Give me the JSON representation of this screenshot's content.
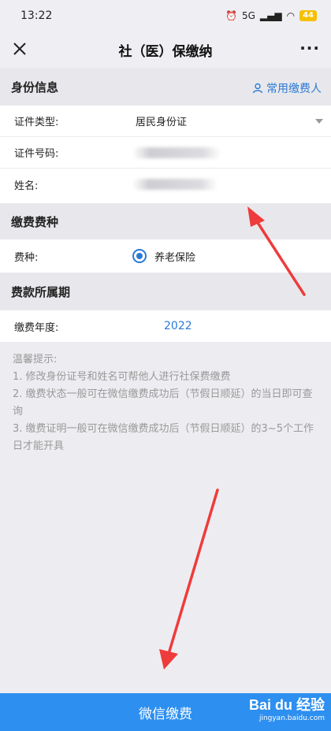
{
  "status_bar": {
    "time": "13:22",
    "signal": "5G",
    "battery": "44"
  },
  "nav": {
    "title": "社（医）保缴纳"
  },
  "identity": {
    "header": "身份信息",
    "frequent_payer": "常用缴费人",
    "rows": [
      {
        "label": "证件类型:",
        "value": "居民身份证"
      },
      {
        "label": "证件号码:",
        "value": ""
      },
      {
        "label": "姓名:",
        "value": ""
      }
    ]
  },
  "fee_type": {
    "header": "缴费费种",
    "label": "费种:",
    "option": "养老保险"
  },
  "period": {
    "header": "费款所属期",
    "label": "缴费年度:",
    "year": "2022"
  },
  "tips": [
    "温馨提示:",
    "1. 修改身份证号和姓名可帮他人进行社保费缴费",
    "2. 缴费状态一般可在微信缴费成功后（节假日顺延）的当日即可查询",
    "3. 缴费证明一般可在微信缴费成功后（节假日顺延）的3~5个工作日才能开具"
  ],
  "footer": {
    "pay_button": "微信缴费"
  },
  "watermark": {
    "logo": "Bai du 经验",
    "url": "jingyan.baidu.com"
  },
  "colors": {
    "accent": "#2a7ad5",
    "footer": "#2d8ff0",
    "arrow": "#ee3b3b"
  }
}
